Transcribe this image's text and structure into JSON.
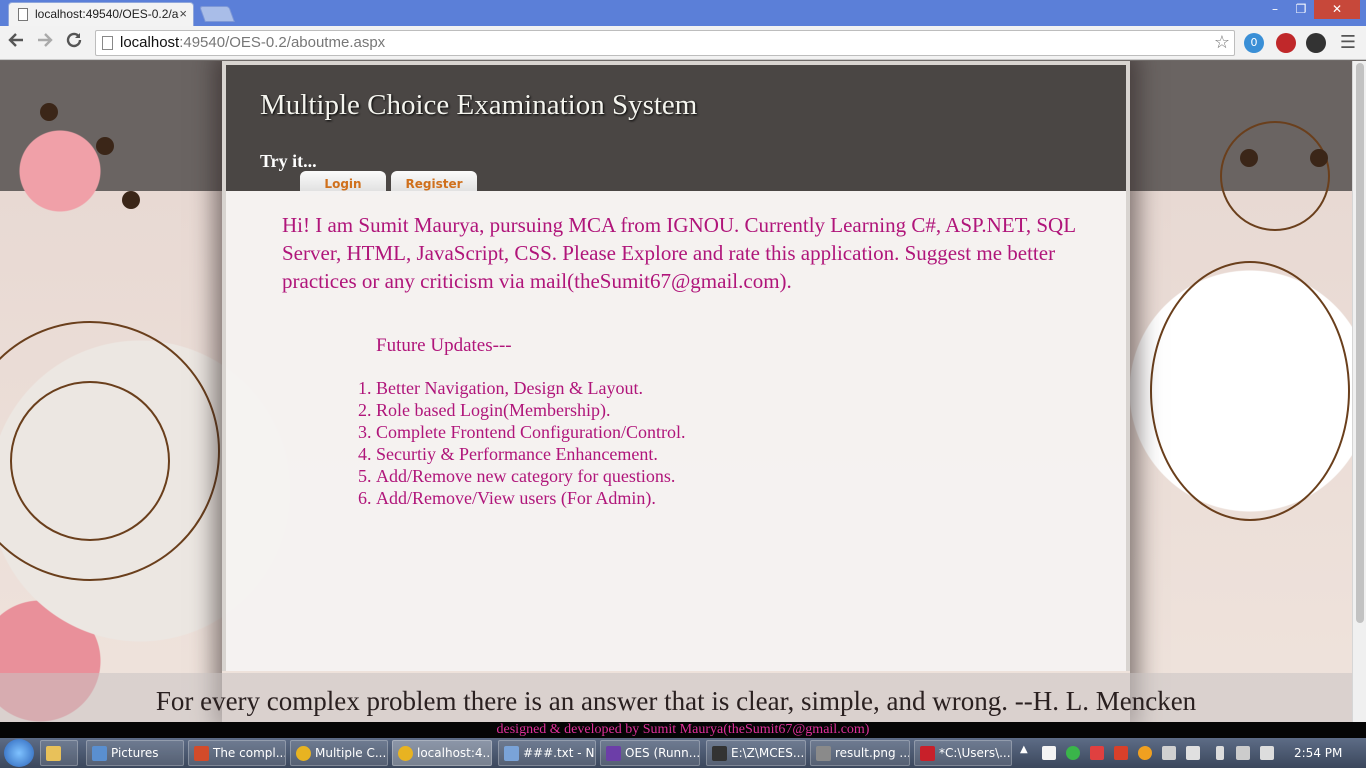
{
  "browser": {
    "tab_title": "localhost:49540/OES-0.2/a",
    "tab_close": "×",
    "url_host": "localhost",
    "url_rest": ":49540/OES-0.2/aboutme.aspx",
    "window_controls": {
      "minimize": "–",
      "restore": "❐",
      "close": "✕"
    },
    "icons": {
      "back": "arrow-left-icon",
      "forward": "arrow-right-icon",
      "reload": "reload-icon",
      "star": "star-icon",
      "menu": "hamburger-menu-icon"
    },
    "ext_badge": "0"
  },
  "page": {
    "site_title": "Multiple Choice Examination System",
    "tagline": "Try  it...",
    "nav": {
      "login": "Login",
      "register": "Register"
    },
    "intro": "Hi! I am Sumit Maurya, pursuing MCA from IGNOU. Currently Learning C#, ASP.NET, SQL Server, HTML, JavaScript, CSS. Please Explore and rate this application. Suggest me better practices or any criticism via mail(theSumit67@gmail.com).",
    "updates_heading": "Future Updates---",
    "updates": [
      "Better Navigation, Design & Layout.",
      "Role based Login(Membership).",
      "Complete Frontend Configuration/Control.",
      "Securtiy & Performance Enhancement.",
      "Add/Remove new category for questions.",
      "Add/Remove/View users (For Admin)."
    ],
    "quote": "For every complex problem there is an answer that is clear, simple, and wrong. --H. L. Mencken",
    "footer": "designed & developed by Sumit Maurya(theSumit67@gmail.com)"
  },
  "taskbar": {
    "items": [
      {
        "label": "Pictures",
        "color": "#5a8fd0"
      },
      {
        "label": "The compl...",
        "color": "#d24b2a"
      },
      {
        "label": "Multiple C...",
        "color": "#e8b321"
      },
      {
        "label": "localhost:4...",
        "color": "#e8b321"
      },
      {
        "label": "###.txt - N...",
        "color": "#7aa3d8"
      },
      {
        "label": "OES (Runn...",
        "color": "#6c3ea8"
      },
      {
        "label": "E:\\Z\\MCES...",
        "color": "#333333"
      },
      {
        "label": "result.png ...",
        "color": "#8a8a8a"
      },
      {
        "label": "*C:\\Users\\...",
        "color": "#c8202a"
      }
    ],
    "clock": "2:54 PM"
  }
}
